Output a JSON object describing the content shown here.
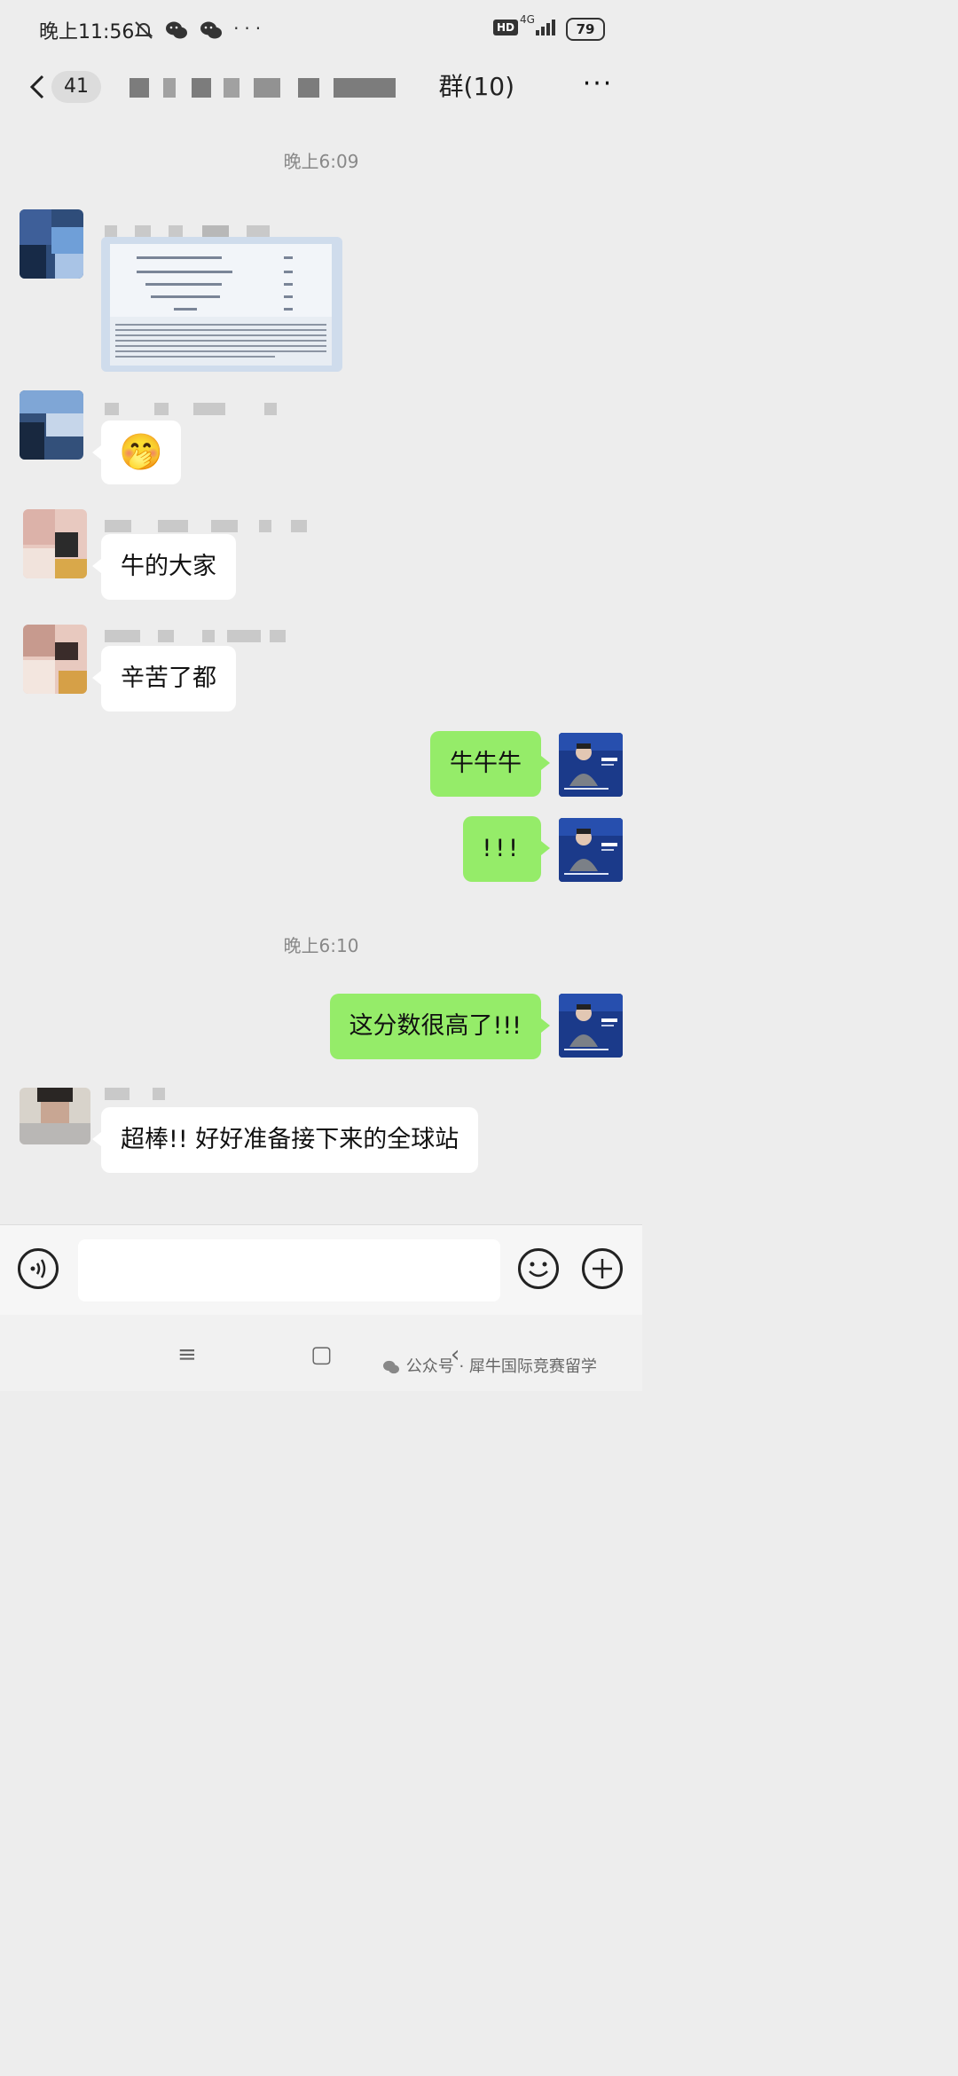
{
  "status_bar": {
    "time": "晚上11:56",
    "hd_badge": "HD",
    "network": "4G",
    "battery": "79"
  },
  "header": {
    "unread_count": "41",
    "title_visible_suffix": "群(10)",
    "more_label": "···"
  },
  "timestamps": [
    "晚上6:09",
    "晚上6:10"
  ],
  "messages": [
    {
      "side": "left",
      "type": "image"
    },
    {
      "side": "left",
      "type": "emoji",
      "emoji": "🤭"
    },
    {
      "side": "left",
      "type": "text",
      "text": "牛的大家"
    },
    {
      "side": "left",
      "type": "text",
      "text": "辛苦了都"
    },
    {
      "side": "right",
      "type": "text",
      "text": "牛牛牛"
    },
    {
      "side": "right",
      "type": "text",
      "text": "!!!"
    },
    {
      "side": "right",
      "type": "text",
      "text": "这分数很高了!!!"
    },
    {
      "side": "left",
      "type": "text",
      "text": "超棒!! 好好准备接下来的全球站"
    }
  ],
  "photo": {
    "rows": [
      {
        "label": "Problem Understanding and Analysis(20%)",
        "score": "27.1"
      },
      {
        "label": "Knowledge Adaptation and Application(20%)",
        "score": "15.2"
      },
      {
        "label": "Critical Thinking and Insight(40%)",
        "score": "36.5"
      },
      {
        "label": "Structure and Expression(20%)",
        "score": "11.2"
      },
      {
        "label": "Overall",
        "score": "25.7"
      }
    ]
  },
  "my_avatar_card": {
    "name": "郭老师",
    "phone": "180 · 1653 · 3106"
  },
  "input_bar": {
    "voice_icon": "voice-icon",
    "emoji_icon": "emoji-icon",
    "plus_icon": "plus-icon"
  },
  "system_nav": {
    "menu": "≡",
    "home": "▢",
    "back": "‹"
  },
  "watermark": "公众号 · 犀牛国际竞赛留学",
  "colors": {
    "background": "#ededed",
    "outgoing_bubble": "#95ec69",
    "incoming_bubble": "#ffffff"
  }
}
